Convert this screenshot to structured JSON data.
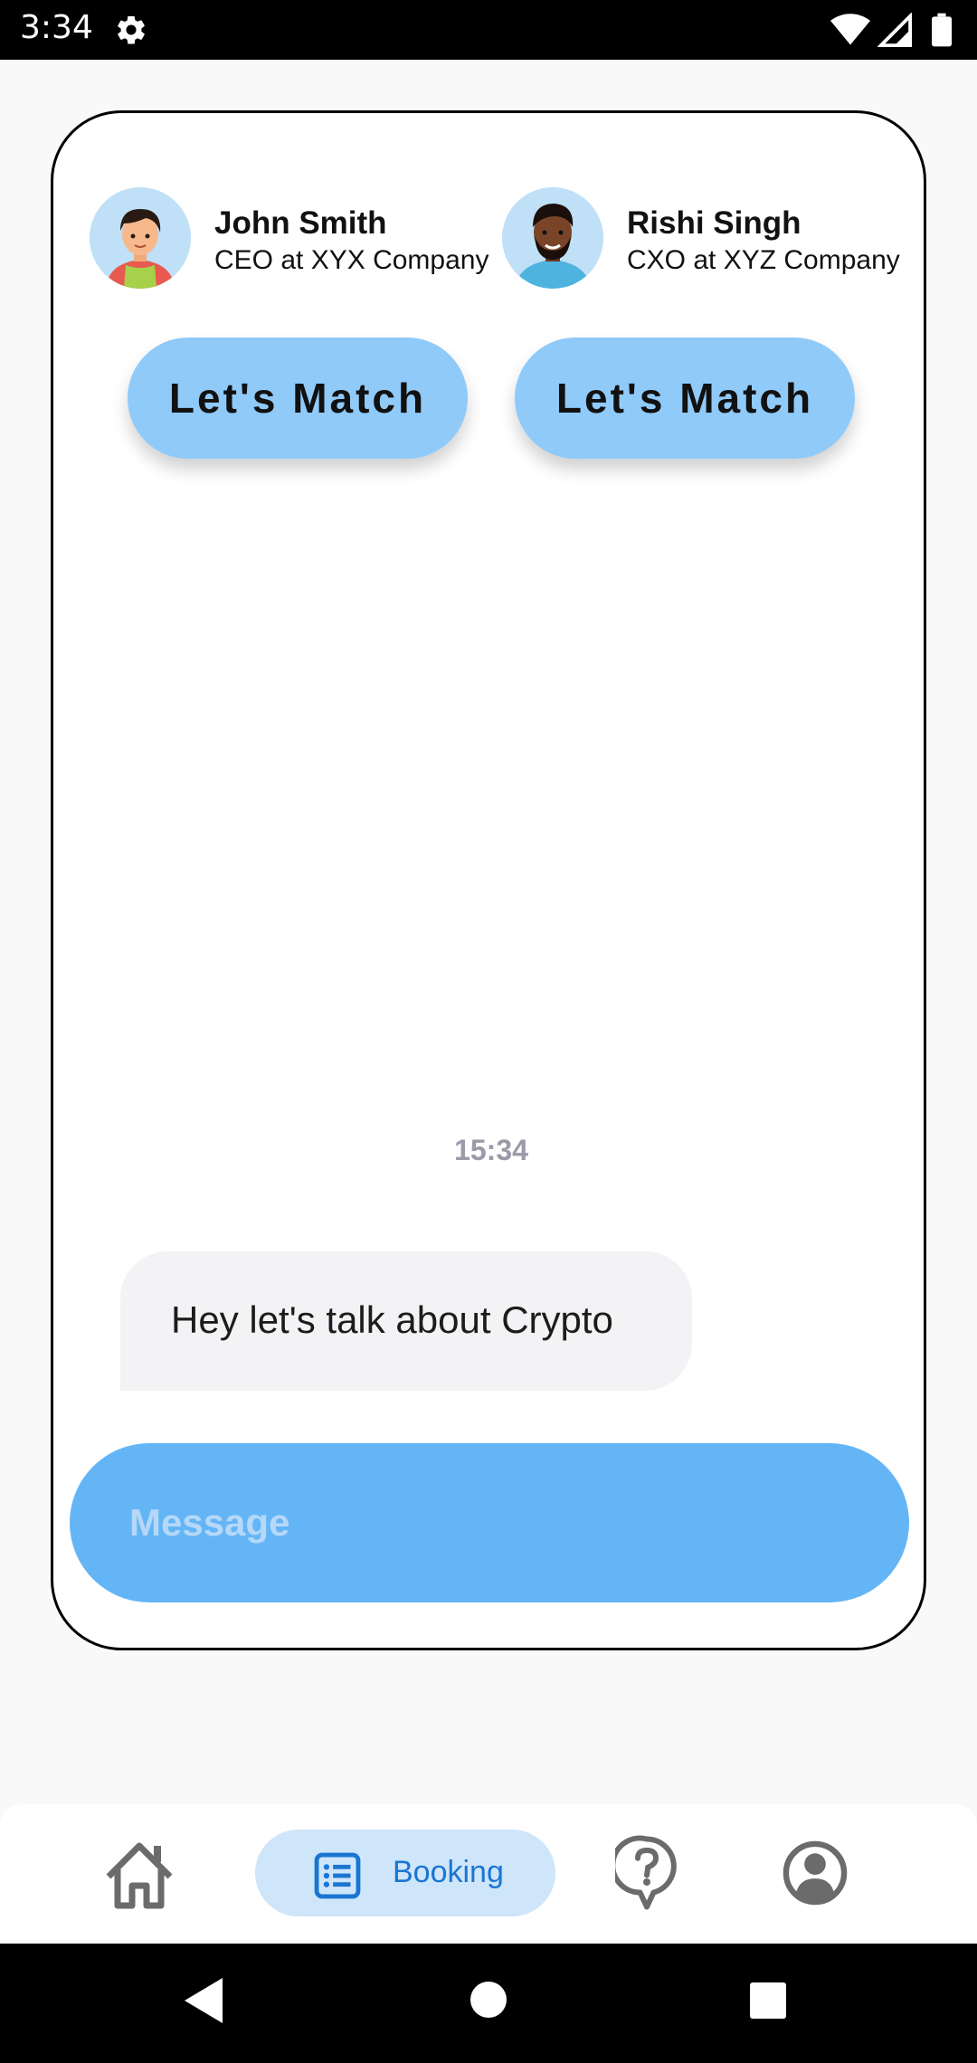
{
  "status_bar": {
    "time": "3:34",
    "icons": [
      "gear-icon",
      "wifi-icon",
      "signal-icon",
      "battery-icon"
    ]
  },
  "profiles": [
    {
      "name": "John Smith",
      "role": "CEO at XYX Company",
      "avatar": "avatar-john-icon"
    },
    {
      "name": "Rishi Singh",
      "role": "CXO at XYZ Company",
      "avatar": "avatar-rishi-icon"
    }
  ],
  "match_buttons": [
    {
      "label": "Let's Match"
    },
    {
      "label": "Let's Match"
    }
  ],
  "chat": {
    "timestamp": "15:34",
    "messages": [
      {
        "text": "Hey let's talk about Crypto"
      }
    ],
    "input": {
      "placeholder": "Message",
      "value": ""
    }
  },
  "bottom_nav": {
    "items": [
      {
        "icon": "home-icon",
        "label": ""
      },
      {
        "icon": "list-icon",
        "label": "Booking",
        "active": true
      },
      {
        "icon": "help-icon",
        "label": ""
      },
      {
        "icon": "account-icon",
        "label": ""
      }
    ]
  },
  "colors": {
    "accent": "#64b5f6",
    "button": "#90caf9",
    "active_nav_bg": "#cfe5fa",
    "active_nav_text": "#1976d2"
  }
}
